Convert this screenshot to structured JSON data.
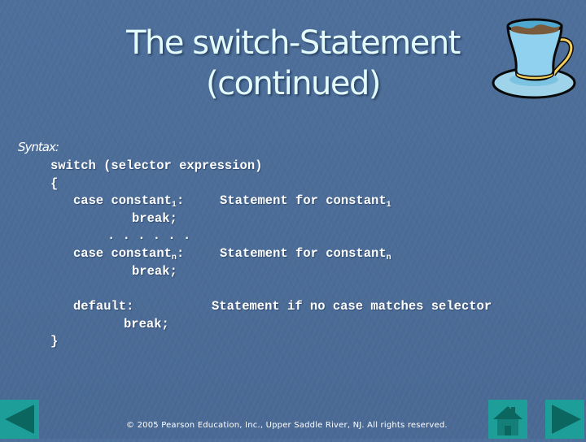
{
  "slide": {
    "title_line1": "The switch-Statement",
    "title_line2": "(continued)",
    "syntax_label": "Syntax:",
    "code": {
      "line_switch": "switch (selector expression)",
      "open_brace": "{",
      "case1_keyword": "case constant",
      "case1_sub": "1",
      "case1_colon": ":",
      "case1_stmt": "Statement for constant",
      "case1_stmt_sub": "1",
      "break1": "break;",
      "ellipsis": ". . . . . .",
      "casen_keyword": "case constant",
      "casen_sub": "n",
      "casen_colon": ":",
      "casen_stmt": "Statement for constant",
      "casen_stmt_sub": "n",
      "breakn": "break;",
      "default_keyword": "default:",
      "default_stmt": "Statement if no case matches selector",
      "break_default": "break;",
      "close_brace": "}"
    },
    "footer": {
      "copyright": "© 2005 Pearson Education, Inc., Upper Saddle River, NJ.  All rights reserved."
    },
    "nav": {
      "prev_icon": "triangle-left",
      "home_icon": "house",
      "next_icon": "triangle-right",
      "button_color": "#1e9e98",
      "glyph_color": "#0b6660"
    },
    "clipart": "coffee-cup-icon"
  }
}
